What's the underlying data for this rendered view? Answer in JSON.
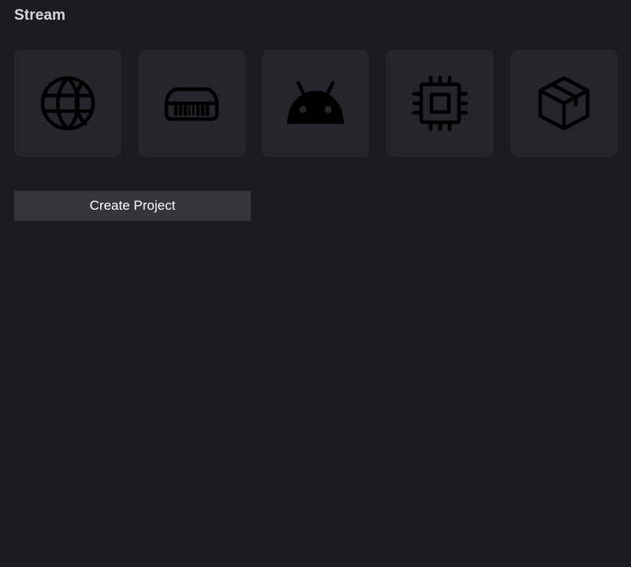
{
  "header": {
    "title": "Stream"
  },
  "tiles": [
    {
      "icon": "globe-icon"
    },
    {
      "icon": "server-icon"
    },
    {
      "icon": "android-icon"
    },
    {
      "icon": "cpu-chip-icon"
    },
    {
      "icon": "package-box-icon"
    }
  ],
  "actions": {
    "create_project_label": "Create Project"
  },
  "colors": {
    "background": "#1c1b20",
    "tile": "#25252b",
    "button": "#35353a",
    "icon": "#000000",
    "title": "#d8d8dc",
    "button_text": "#ffffff"
  }
}
